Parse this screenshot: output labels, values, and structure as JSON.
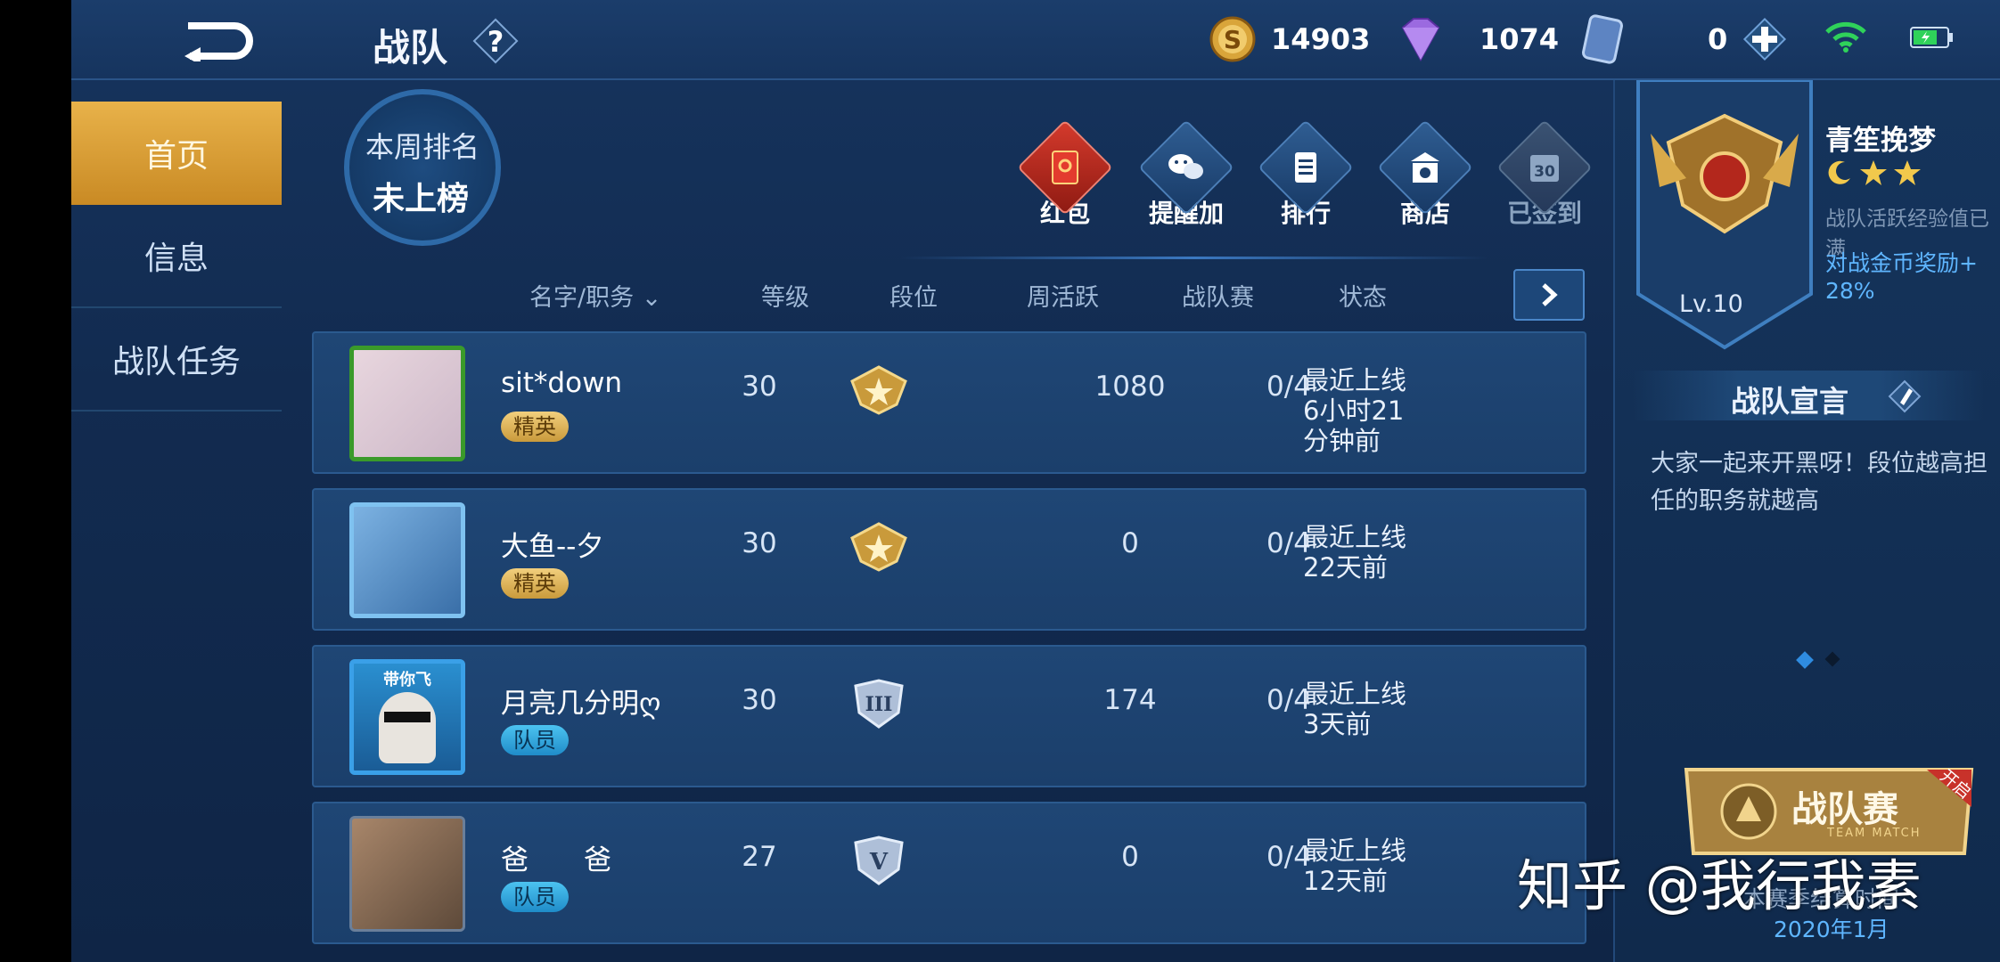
{
  "header": {
    "title": "战队",
    "help_symbol": "?",
    "gold": "14903",
    "diamonds": "1074",
    "tickets": "0",
    "add_symbol": "+"
  },
  "nav": {
    "items": [
      {
        "label": "首页",
        "active": true
      },
      {
        "label": "信息",
        "active": false
      },
      {
        "label": "战队任务",
        "active": false
      }
    ]
  },
  "weekly_rank": {
    "label": "本周排名",
    "value": "未上榜"
  },
  "actions": [
    {
      "label": "红包",
      "icon": "red-envelope-icon"
    },
    {
      "label": "提醒加",
      "icon": "wechat-link-icon"
    },
    {
      "label": "排行",
      "icon": "ranking-icon"
    },
    {
      "label": "商店",
      "icon": "shop-icon"
    },
    {
      "label": "已签到",
      "icon": "calendar-checked-icon",
      "badge": "30"
    }
  ],
  "table": {
    "headers": [
      "名字/职务",
      "等级",
      "段位",
      "周活跃",
      "战队赛",
      "状态"
    ],
    "rows": [
      {
        "name": "sit*down",
        "role": "精英",
        "level": "30",
        "weekly_active": "1080",
        "team_match": "0/4",
        "status_line1": "最近上线",
        "status_line2": "6小时21",
        "status_line3": "分钟前"
      },
      {
        "name": "大鱼--夕",
        "role": "精英",
        "level": "30",
        "weekly_active": "0",
        "team_match": "0/4",
        "status_line1": "最近上线",
        "status_line2": "22天前",
        "status_line3": ""
      },
      {
        "name": "月亮几分明ღ",
        "role": "队员",
        "level": "30",
        "weekly_active": "174",
        "team_match": "0/4",
        "status_line1": "最近上线",
        "status_line2": "3天前",
        "status_line3": "",
        "avatar_text": "带你飞"
      },
      {
        "name": "爸　　爸",
        "role": "队员",
        "level": "27",
        "weekly_active": "0",
        "team_match": "0/4",
        "status_line1": "最近上线",
        "status_line2": "12天前",
        "status_line3": ""
      }
    ],
    "rank_badges": [
      "V"
    ]
  },
  "team": {
    "name": "青笙挽梦",
    "activity_note": "战队活跃经验值已满",
    "bonus": "对战金币奖励+ 28%",
    "level": "Lv.10"
  },
  "declaration": {
    "title": "战队宣言",
    "text": "大家一起来开黑呀！段位越高担任的职务就越高"
  },
  "team_match": {
    "title": "战队赛",
    "subtitle": "TEAM MATCH",
    "tag": "开启",
    "note": "本赛季结算时间",
    "date": "2020年1月"
  },
  "watermark": "知乎 @我行我素",
  "colors": {
    "accent_gold": "#e8b24a",
    "elite_tag": "#d9b25a",
    "member_tag": "#2fa8e0",
    "bonus_text": "#5fb6ff",
    "background": "#132d52"
  }
}
